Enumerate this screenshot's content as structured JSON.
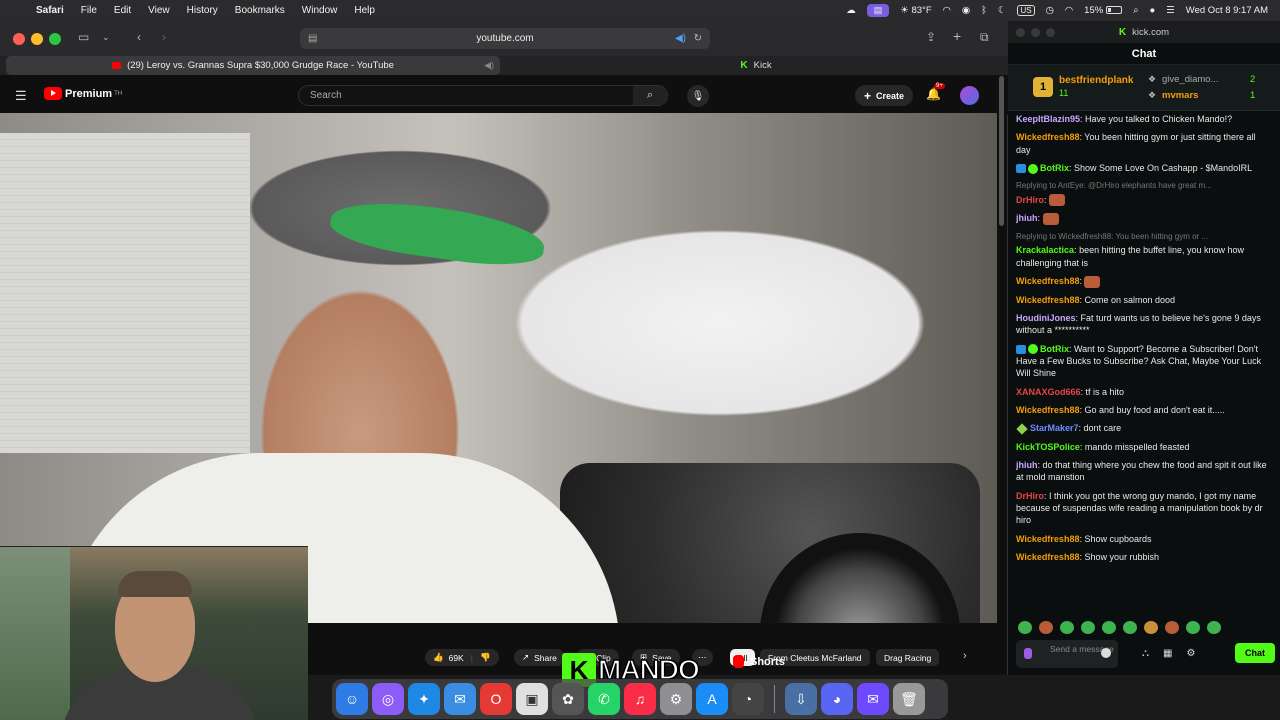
{
  "menubar": {
    "app": "Safari",
    "items": [
      "File",
      "Edit",
      "View",
      "History",
      "Bookmarks",
      "Window",
      "Help"
    ],
    "weather": "83°F",
    "input_source": "US",
    "battery": "15%",
    "datetime": "Wed Oct 8  9:17 AM"
  },
  "safari": {
    "url": "youtube.com",
    "tabs": [
      {
        "label": "(29) Leroy vs. Grannas Supra $30,000 Grudge Race - YouTube",
        "active": true
      },
      {
        "label": "Kick",
        "active": false
      }
    ]
  },
  "youtube": {
    "logo": "Premium",
    "logo_sup": "TH",
    "search_placeholder": "Search",
    "create_label": "Create",
    "notif_badge": "9+",
    "actions": {
      "likes": "69K",
      "share": "Share",
      "clip": "Clip",
      "save": "Save"
    },
    "chips": [
      "All",
      "From Cleetus McFarland",
      "Drag Racing"
    ],
    "shorts_label": "Shorts"
  },
  "overlay": {
    "kick_letter": "K",
    "name": "MANDO"
  },
  "kick": {
    "window_title": "kick.com",
    "chat_title": "Chat",
    "leaderboard": {
      "rank": "1",
      "top_name": "bestfriendplank",
      "top_count": "11",
      "second_name": "give_diamo...",
      "second_count": "2",
      "third_name": "mvmars",
      "third_count": "1"
    },
    "messages": [
      {
        "user": "KeepItBlazin95",
        "color": "#c9a7ff",
        "text": "Have you talked to Chicken Mando!?"
      },
      {
        "user": "Wickedfresh88",
        "color": "#f59e0b",
        "text": "You been hitting gym or just sitting there all day"
      },
      {
        "user": "BotRix",
        "color": "#53fc18",
        "text": "Show Some Love On Cashapp - $MandoIRL",
        "bot": true
      },
      {
        "reply": "Replying to AntEye: @DrHiro elephants have great m..."
      },
      {
        "user": "DrHiro",
        "color": "#e64545",
        "text": "",
        "emote": true
      },
      {
        "user": "jhiuh",
        "color": "#c9a7ff",
        "text": "",
        "emote": true
      },
      {
        "reply": "Replying to Wickedfresh88: You been hitting gym or ..."
      },
      {
        "user": "Krackalactica",
        "color": "#53fc18",
        "text": "been hitting the buffet line, you know how challenging that is"
      },
      {
        "user": "Wickedfresh88",
        "color": "#f59e0b",
        "text": "",
        "emote": true
      },
      {
        "user": "Wickedfresh88",
        "color": "#f59e0b",
        "text": "Come on salmon dood"
      },
      {
        "user": "HoudiniJones",
        "color": "#c9a7ff",
        "text": "Fat turd wants us to believe he's gone 9 days without a **********"
      },
      {
        "user": "BotRix",
        "color": "#53fc18",
        "text": "Want to Support? Become a Subscriber! Don't Have a Few Bucks to Subscribe? Ask Chat, Maybe Your Luck Will Shine",
        "bot": true
      },
      {
        "user": "XANAXGod666",
        "color": "#e64545",
        "text": "tf is a hito"
      },
      {
        "user": "Wickedfresh88",
        "color": "#f59e0b",
        "text": "Go and buy food and don't eat it....."
      },
      {
        "user": "StarMaker7",
        "color": "#6b8cff",
        "text": "dont care",
        "diamond": true
      },
      {
        "user": "KickTOSPolice",
        "color": "#53fc18",
        "text": "mando misspelled feasted"
      },
      {
        "user": "jhiuh",
        "color": "#c9a7ff",
        "text": "do that thing where you chew the food and spit it out like at mold manstion"
      },
      {
        "user": "DrHiro",
        "color": "#e64545",
        "text": "I think you got the wrong guy mando, I got my name because of suspendas wife reading a manipulation book by dr hiro"
      },
      {
        "user": "Wickedfresh88",
        "color": "#f59e0b",
        "text": "Show cupboards"
      },
      {
        "user": "Wickedfresh88",
        "color": "#f59e0b",
        "text": "Show your rubbish"
      }
    ],
    "composer_placeholder": "Send a message",
    "chat_button": "Chat"
  }
}
